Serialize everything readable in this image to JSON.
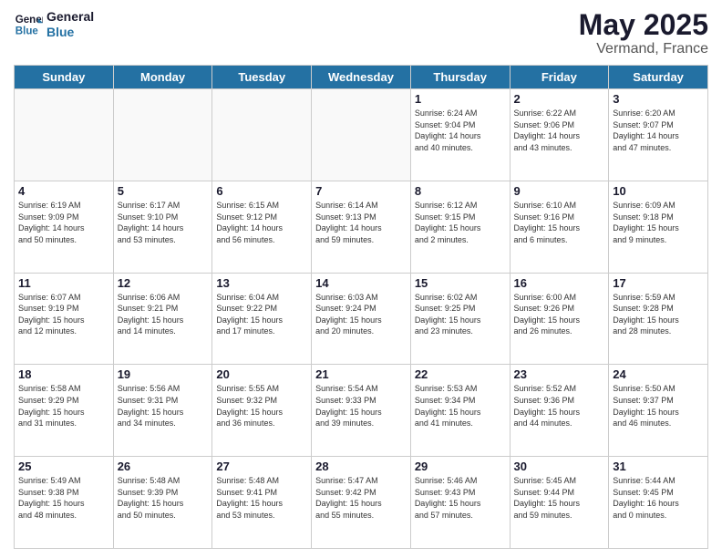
{
  "header": {
    "logo_general": "General",
    "logo_blue": "Blue",
    "title": "May 2025",
    "subtitle": "Vermand, France"
  },
  "days_of_week": [
    "Sunday",
    "Monday",
    "Tuesday",
    "Wednesday",
    "Thursday",
    "Friday",
    "Saturday"
  ],
  "weeks": [
    [
      {
        "day": "",
        "info": ""
      },
      {
        "day": "",
        "info": ""
      },
      {
        "day": "",
        "info": ""
      },
      {
        "day": "",
        "info": ""
      },
      {
        "day": "1",
        "info": "Sunrise: 6:24 AM\nSunset: 9:04 PM\nDaylight: 14 hours\nand 40 minutes."
      },
      {
        "day": "2",
        "info": "Sunrise: 6:22 AM\nSunset: 9:06 PM\nDaylight: 14 hours\nand 43 minutes."
      },
      {
        "day": "3",
        "info": "Sunrise: 6:20 AM\nSunset: 9:07 PM\nDaylight: 14 hours\nand 47 minutes."
      }
    ],
    [
      {
        "day": "4",
        "info": "Sunrise: 6:19 AM\nSunset: 9:09 PM\nDaylight: 14 hours\nand 50 minutes."
      },
      {
        "day": "5",
        "info": "Sunrise: 6:17 AM\nSunset: 9:10 PM\nDaylight: 14 hours\nand 53 minutes."
      },
      {
        "day": "6",
        "info": "Sunrise: 6:15 AM\nSunset: 9:12 PM\nDaylight: 14 hours\nand 56 minutes."
      },
      {
        "day": "7",
        "info": "Sunrise: 6:14 AM\nSunset: 9:13 PM\nDaylight: 14 hours\nand 59 minutes."
      },
      {
        "day": "8",
        "info": "Sunrise: 6:12 AM\nSunset: 9:15 PM\nDaylight: 15 hours\nand 2 minutes."
      },
      {
        "day": "9",
        "info": "Sunrise: 6:10 AM\nSunset: 9:16 PM\nDaylight: 15 hours\nand 6 minutes."
      },
      {
        "day": "10",
        "info": "Sunrise: 6:09 AM\nSunset: 9:18 PM\nDaylight: 15 hours\nand 9 minutes."
      }
    ],
    [
      {
        "day": "11",
        "info": "Sunrise: 6:07 AM\nSunset: 9:19 PM\nDaylight: 15 hours\nand 12 minutes."
      },
      {
        "day": "12",
        "info": "Sunrise: 6:06 AM\nSunset: 9:21 PM\nDaylight: 15 hours\nand 14 minutes."
      },
      {
        "day": "13",
        "info": "Sunrise: 6:04 AM\nSunset: 9:22 PM\nDaylight: 15 hours\nand 17 minutes."
      },
      {
        "day": "14",
        "info": "Sunrise: 6:03 AM\nSunset: 9:24 PM\nDaylight: 15 hours\nand 20 minutes."
      },
      {
        "day": "15",
        "info": "Sunrise: 6:02 AM\nSunset: 9:25 PM\nDaylight: 15 hours\nand 23 minutes."
      },
      {
        "day": "16",
        "info": "Sunrise: 6:00 AM\nSunset: 9:26 PM\nDaylight: 15 hours\nand 26 minutes."
      },
      {
        "day": "17",
        "info": "Sunrise: 5:59 AM\nSunset: 9:28 PM\nDaylight: 15 hours\nand 28 minutes."
      }
    ],
    [
      {
        "day": "18",
        "info": "Sunrise: 5:58 AM\nSunset: 9:29 PM\nDaylight: 15 hours\nand 31 minutes."
      },
      {
        "day": "19",
        "info": "Sunrise: 5:56 AM\nSunset: 9:31 PM\nDaylight: 15 hours\nand 34 minutes."
      },
      {
        "day": "20",
        "info": "Sunrise: 5:55 AM\nSunset: 9:32 PM\nDaylight: 15 hours\nand 36 minutes."
      },
      {
        "day": "21",
        "info": "Sunrise: 5:54 AM\nSunset: 9:33 PM\nDaylight: 15 hours\nand 39 minutes."
      },
      {
        "day": "22",
        "info": "Sunrise: 5:53 AM\nSunset: 9:34 PM\nDaylight: 15 hours\nand 41 minutes."
      },
      {
        "day": "23",
        "info": "Sunrise: 5:52 AM\nSunset: 9:36 PM\nDaylight: 15 hours\nand 44 minutes."
      },
      {
        "day": "24",
        "info": "Sunrise: 5:50 AM\nSunset: 9:37 PM\nDaylight: 15 hours\nand 46 minutes."
      }
    ],
    [
      {
        "day": "25",
        "info": "Sunrise: 5:49 AM\nSunset: 9:38 PM\nDaylight: 15 hours\nand 48 minutes."
      },
      {
        "day": "26",
        "info": "Sunrise: 5:48 AM\nSunset: 9:39 PM\nDaylight: 15 hours\nand 50 minutes."
      },
      {
        "day": "27",
        "info": "Sunrise: 5:48 AM\nSunset: 9:41 PM\nDaylight: 15 hours\nand 53 minutes."
      },
      {
        "day": "28",
        "info": "Sunrise: 5:47 AM\nSunset: 9:42 PM\nDaylight: 15 hours\nand 55 minutes."
      },
      {
        "day": "29",
        "info": "Sunrise: 5:46 AM\nSunset: 9:43 PM\nDaylight: 15 hours\nand 57 minutes."
      },
      {
        "day": "30",
        "info": "Sunrise: 5:45 AM\nSunset: 9:44 PM\nDaylight: 15 hours\nand 59 minutes."
      },
      {
        "day": "31",
        "info": "Sunrise: 5:44 AM\nSunset: 9:45 PM\nDaylight: 16 hours\nand 0 minutes."
      }
    ]
  ]
}
